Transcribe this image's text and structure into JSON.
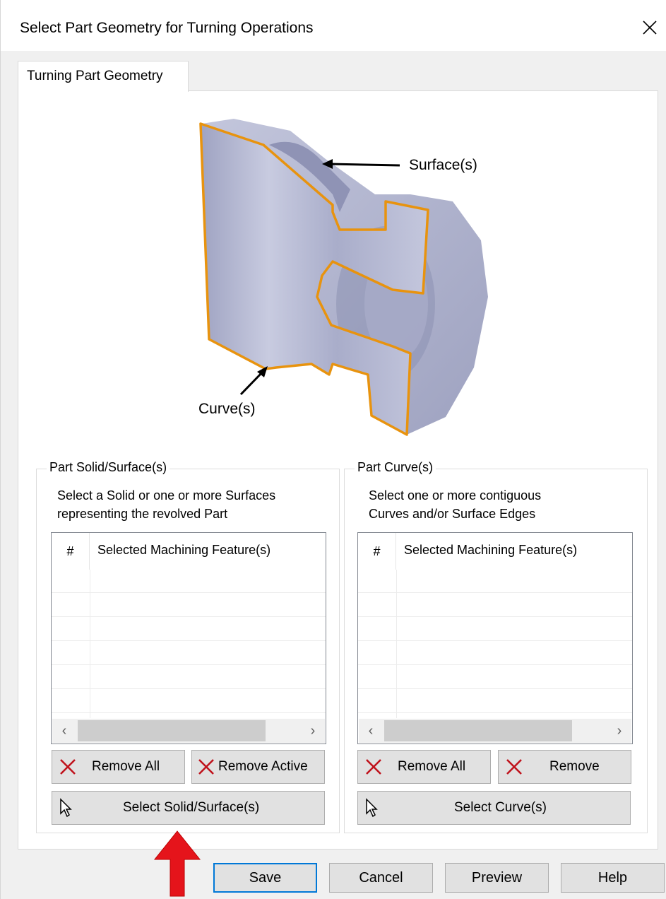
{
  "window": {
    "title": "Select Part Geometry for Turning Operations",
    "close_icon": "close-icon"
  },
  "tabs": [
    {
      "label": "Turning Part Geometry",
      "active": true
    }
  ],
  "illustration": {
    "surface_label": "Surface(s)",
    "curve_label": "Curve(s)",
    "colors": {
      "part": "#b9bdd6",
      "edge": "#e8930e"
    }
  },
  "left_group": {
    "legend": "Part Solid/Surface(s)",
    "description_line1": "Select a Solid or one or more Surfaces",
    "description_line2": "representing the revolved Part",
    "list": {
      "col_num": "#",
      "col_feature": "Selected Machining Feature(s)"
    },
    "scroll_left_icon": "‹",
    "scroll_right_icon": "›",
    "remove_all_label": "Remove All",
    "remove_active_label": "Remove Active",
    "select_label": "Select Solid/Surface(s)"
  },
  "right_group": {
    "legend": "Part Curve(s)",
    "description_line1": "Select one or more contiguous",
    "description_line2": "Curves and/or Surface Edges",
    "list": {
      "col_num": "#",
      "col_feature": "Selected Machining Feature(s)"
    },
    "scroll_left_icon": "‹",
    "scroll_right_icon": "›",
    "remove_all_label": "Remove All",
    "remove_label": "Remove",
    "select_label": "Select Curve(s)"
  },
  "footer": {
    "save_label": "Save",
    "cancel_label": "Cancel",
    "preview_label": "Preview",
    "help_label": "Help"
  },
  "annotation": {
    "arrow_color": "#e5141b"
  }
}
